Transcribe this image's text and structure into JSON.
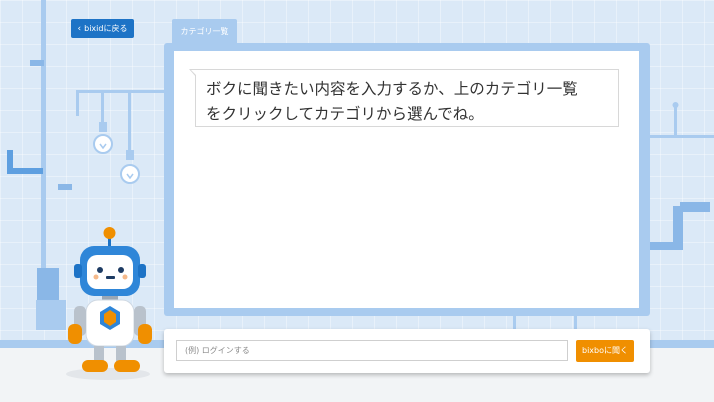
{
  "header": {
    "back_label": "bixidに戻る",
    "tab_label": "カテゴリ一覧"
  },
  "board": {
    "message_line1": "ボクに聞きたい内容を入力するか、上のカテゴリ一覧",
    "message_line2": "をクリックしてカテゴリから選んでね。"
  },
  "chat": {
    "placeholder": "(例) ログインする",
    "ask_label": "bixboに聞く"
  },
  "colors": {
    "accent": "#1d73c6",
    "button": "#f08f00",
    "board": "#a9cbef",
    "background": "#dbe9f7"
  },
  "icons": [
    "chevron-left-icon",
    "lightbulb-icon",
    "robot-mascot"
  ]
}
